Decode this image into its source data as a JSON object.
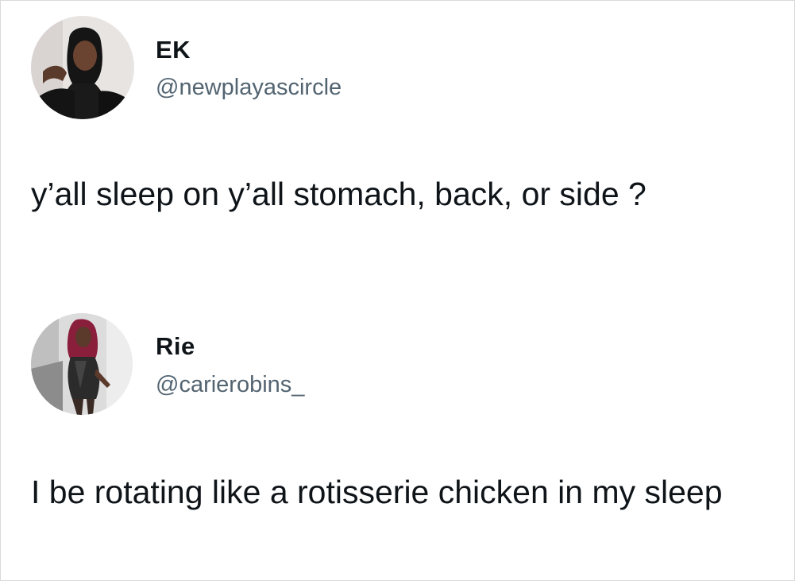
{
  "tweets": [
    {
      "author_name": "EK",
      "author_handle": "@newplayascircle",
      "text": "y’all sleep on y’all stomach, back, or side ?",
      "avatar_icon": "person-avatar-photo"
    },
    {
      "author_name": "Rie",
      "author_handle": "@carierobins_",
      "text": "I be rotating like a rotisserie chicken in my sleep",
      "avatar_icon": "person-avatar-photo"
    }
  ],
  "colors": {
    "text": "#0f1419",
    "handle": "#536471",
    "background": "#ffffff"
  }
}
